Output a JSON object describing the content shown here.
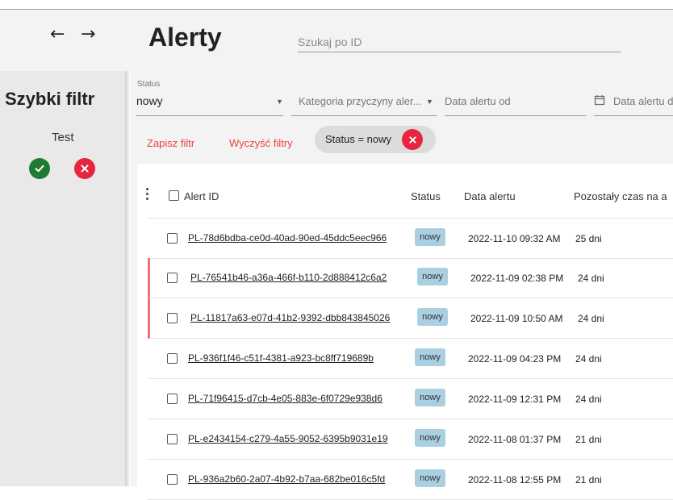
{
  "header": {
    "back_icon": "←",
    "forward_icon": "→",
    "title": "Alerty",
    "search_placeholder": "Szukaj po ID"
  },
  "sidebar": {
    "title": "Szybki filtr",
    "item": "Test",
    "ok_icon": "check-icon",
    "remove_icon": "close-icon"
  },
  "filters": {
    "status_label": "Status",
    "status_value": "nowy",
    "category_placeholder": "Kategoria przyczyny aler...",
    "date_from_placeholder": "Data alertu od",
    "date_to_placeholder": "Data alertu d",
    "save_filter": "Zapisz filtr",
    "clear_filters": "Wyczyść filtry",
    "chip_label": "Status = nowy"
  },
  "table": {
    "columns": [
      "Alert ID",
      "Status",
      "Data alertu",
      "Pozostały czas na a"
    ],
    "rows": [
      {
        "id": "PL-78d6bdba-ce0d-40ad-90ed-45ddc5eec966",
        "status": "nowy",
        "date": "2022-11-10 09:32 AM",
        "remaining": "25 dni"
      },
      {
        "id": "PL-76541b46-a36a-466f-b110-2d888412c6a2",
        "status": "nowy",
        "date": "2022-11-09 02:38 PM",
        "remaining": "24 dni"
      },
      {
        "id": "PL-11817a63-e07d-41b2-9392-dbb843845026",
        "status": "nowy",
        "date": "2022-11-09 10:50 AM",
        "remaining": "24 dni"
      },
      {
        "id": "PL-936f1f46-c51f-4381-a923-bc8ff719689b",
        "status": "nowy",
        "date": "2022-11-09 04:23 PM",
        "remaining": "24 dni"
      },
      {
        "id": "PL-71f96415-d7cb-4e05-883e-6f0729e938d6",
        "status": "nowy",
        "date": "2022-11-09 12:31 PM",
        "remaining": "24 dni"
      },
      {
        "id": "PL-e2434154-c279-4a55-9052-6395b9031e19",
        "status": "nowy",
        "date": "2022-11-08 01:37 PM",
        "remaining": "21 dni"
      },
      {
        "id": "PL-936a2b60-2a07-4b92-b7aa-682be016c5fd",
        "status": "nowy",
        "date": "2022-11-08 12:55 PM",
        "remaining": "21 dni"
      }
    ]
  },
  "colors": {
    "accent_red": "#e8253f",
    "ok_green": "#1f7a34",
    "badge_blue": "#a9cfe0",
    "flag_red": "#f07070"
  }
}
